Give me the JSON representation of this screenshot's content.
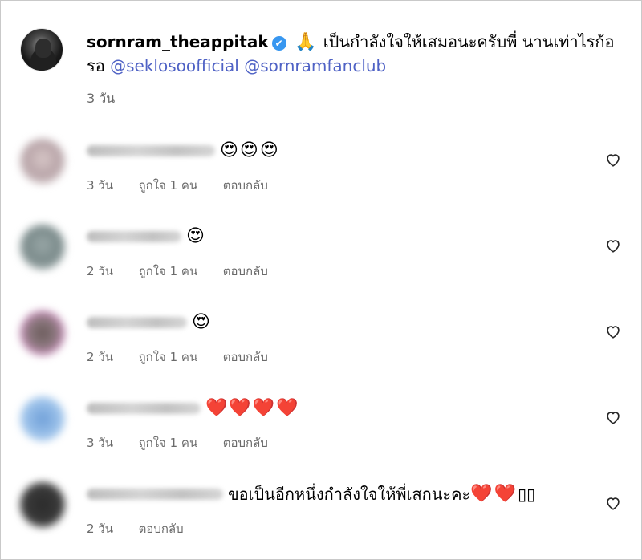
{
  "post": {
    "username": "sornram_theappitak",
    "verified_icon": "✔",
    "pray_emoji": "🙏",
    "text": "เป็นกำลังใจให้เสมอนะครับพี่ นานเท่าไรก้อรอ",
    "mention1": "@seklosoofficial",
    "mention2": "@sornramfanclub",
    "time": "3 วัน"
  },
  "comments": [
    {
      "emoji": "😍😍😍",
      "time": "3 วัน",
      "likes": "ถูกใจ 1 คน",
      "reply": "ตอบกลับ"
    },
    {
      "emoji": "😍",
      "time": "2 วัน",
      "likes": "ถูกใจ 1 คน",
      "reply": "ตอบกลับ"
    },
    {
      "emoji": "😍",
      "time": "2 วัน",
      "likes": "ถูกใจ 1 คน",
      "reply": "ตอบกลับ"
    },
    {
      "emoji": "❤️❤️❤️❤️",
      "time": "3 วัน",
      "likes": "ถูกใจ 1 คน",
      "reply": "ตอบกลับ"
    },
    {
      "text": "ขอเป็นอีกหนึ่งกำลังใจให้พี่เสกนะคะ",
      "emoji": "❤️❤️",
      "trailing": "▯▯",
      "time": "2 วัน",
      "reply": "ตอบกลับ"
    }
  ],
  "icons": {
    "like": "heart-outline-icon"
  },
  "colors": {
    "mention": "#4f62c5",
    "meta": "#6b6b6b",
    "verified": "#3897f0"
  }
}
